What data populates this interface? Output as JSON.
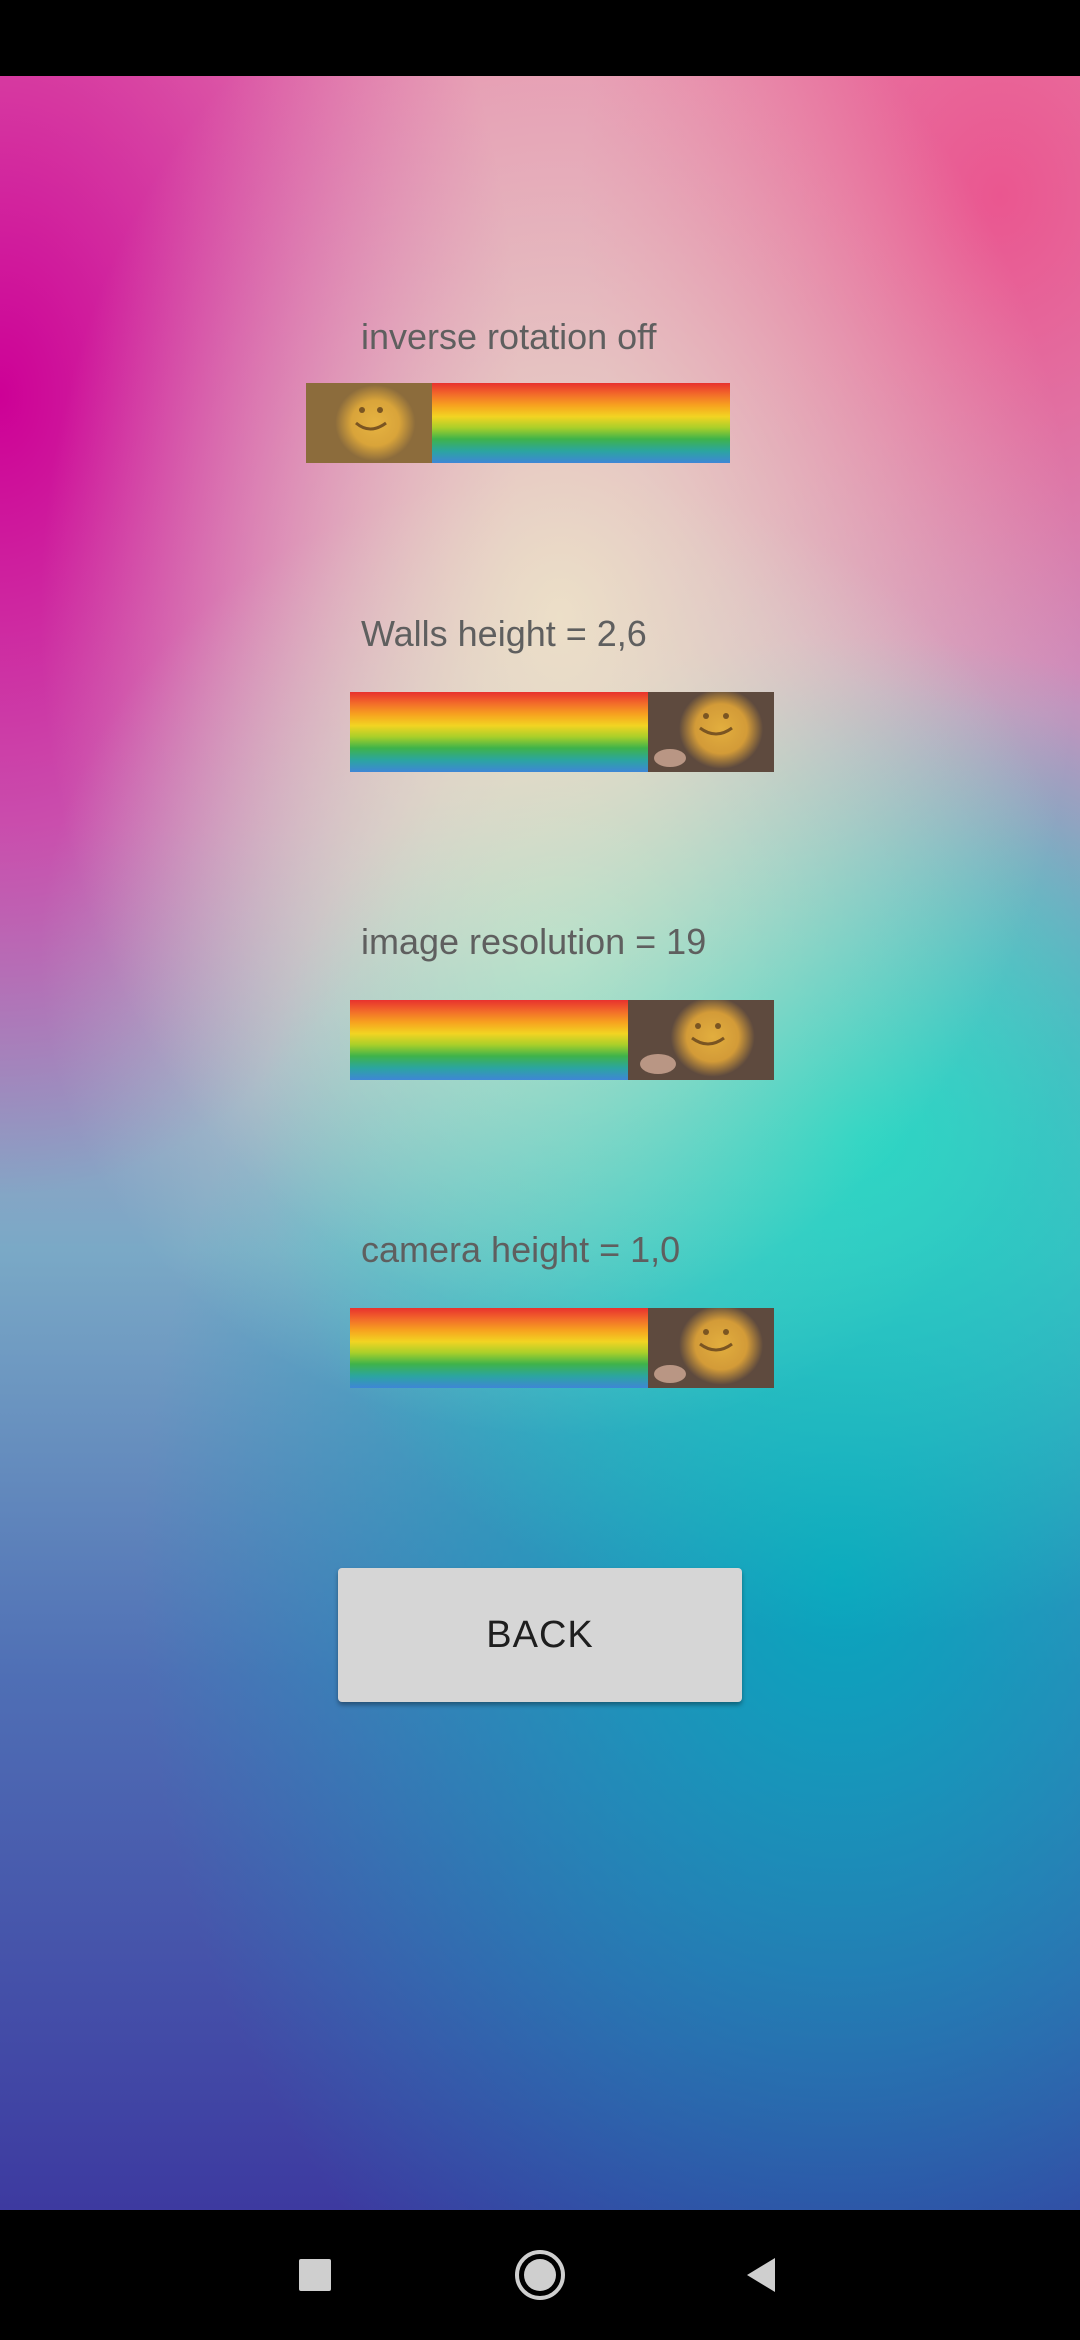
{
  "settings": [
    {
      "label": "inverse rotation off",
      "level": 0.0
    },
    {
      "label": "Walls height = 2,6",
      "level": 1.0
    },
    {
      "label": "image resolution = 19",
      "level": 0.93
    },
    {
      "label": "camera height = 1,0",
      "level": 1.0
    }
  ],
  "back_button": {
    "label": "BACK"
  },
  "nav": {
    "recents_icon": "square-icon",
    "home_icon": "circle-icon",
    "back_icon": "triangle-back-icon"
  },
  "colors": {
    "label_text": "#5f5f5f",
    "button_bg": "#d6d6d6",
    "system_bars": "#000000"
  }
}
